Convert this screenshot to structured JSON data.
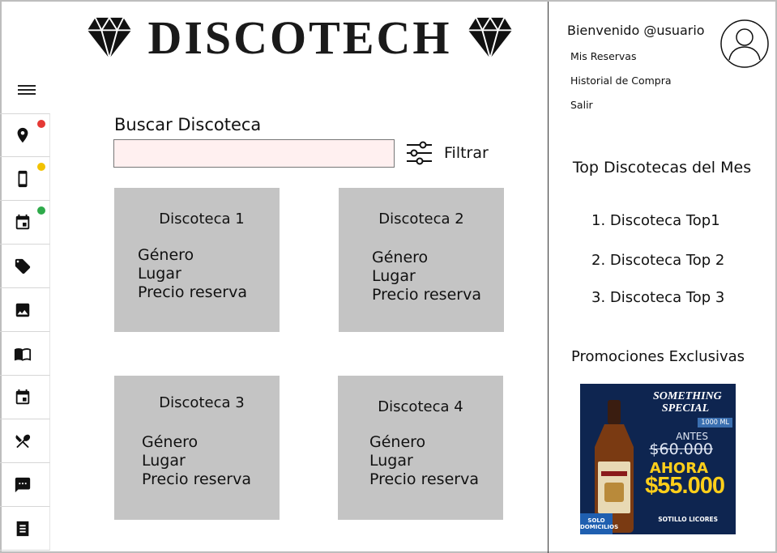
{
  "brand": {
    "name": "DISCOTECH"
  },
  "sidebar": {
    "menu_icon": "hamburger-menu-icon",
    "items": [
      {
        "icon": "location-pin-icon",
        "badge_color": "#e53935"
      },
      {
        "icon": "smartphone-icon",
        "badge_color": "#f2c200"
      },
      {
        "icon": "calendar-event-icon",
        "badge_color": "#2eaa4a"
      },
      {
        "icon": "tag-icon"
      },
      {
        "icon": "image-icon"
      },
      {
        "icon": "book-open-icon"
      },
      {
        "icon": "calendar-icon"
      },
      {
        "icon": "utensils-icon"
      },
      {
        "icon": "chat-icon"
      },
      {
        "icon": "receipt-icon"
      }
    ]
  },
  "search": {
    "label": "Buscar Discoteca",
    "value": "",
    "placeholder": "",
    "filter_label": "Filtrar",
    "filter_icon": "sliders-icon"
  },
  "cards": [
    {
      "title": "Discoteca 1",
      "genre": "Género",
      "place": "Lugar",
      "price": "Precio reserva"
    },
    {
      "title": "Discoteca 2",
      "genre": "Género",
      "place": "Lugar",
      "price": "Precio reserva"
    },
    {
      "title": "Discoteca 3",
      "genre": "Género",
      "place": "Lugar",
      "price": "Precio reserva"
    },
    {
      "title": "Discoteca 4",
      "genre": "Género",
      "place": "Lugar",
      "price": "Precio reserva"
    }
  ],
  "user": {
    "welcome": "Bienvenido @usuario",
    "links": [
      "Mis Reservas",
      "Historial de Compra",
      "Salir"
    ],
    "avatar_icon": "user-avatar-icon"
  },
  "top": {
    "title": "Top Discotecas del Mes",
    "items": [
      "1. Discoteca Top1",
      "2. Discoteca Top 2",
      "3. Discoteca Top 3"
    ]
  },
  "promo": {
    "title": "Promociones Exclusivas",
    "brand": "SOMETHING SPECIAL",
    "size": "1000 ML",
    "antes": "ANTES",
    "old_price": "$60.000",
    "ahora": "AHORA",
    "price": "$55.000",
    "solo": "SOLO DOMICILIOS",
    "seller": "SOTILLO LICORES",
    "colors": {
      "bg": "#0e2550",
      "price": "#ffcf1a"
    }
  }
}
